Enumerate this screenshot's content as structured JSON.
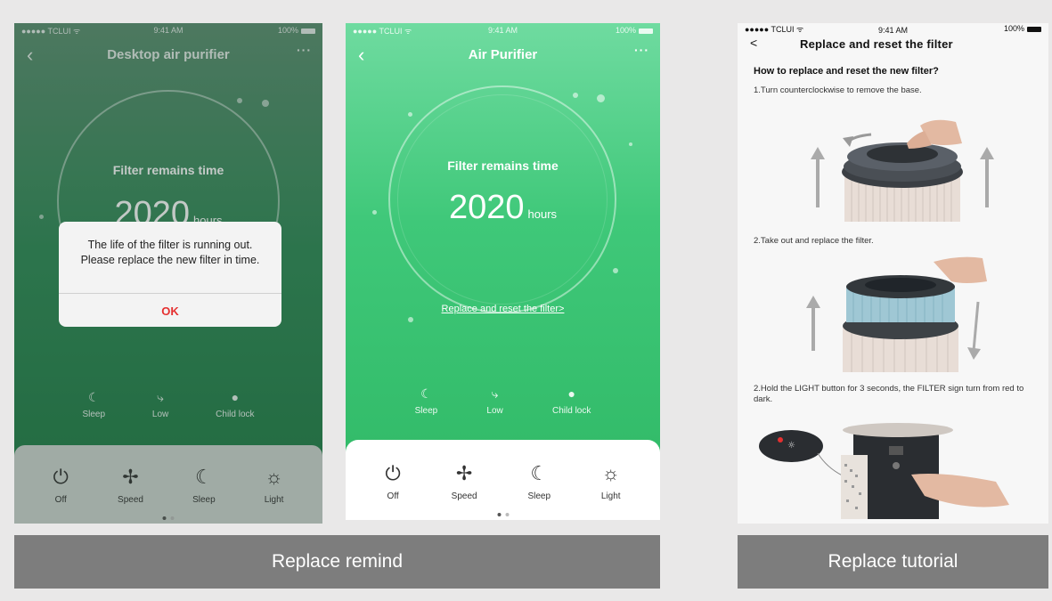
{
  "status": {
    "carrier": "●●●●● TCLUI ᯤ",
    "time": "9:41 AM",
    "battery": "100%"
  },
  "phone1": {
    "title": "Desktop air purifier",
    "filter_label": "Filter remains time",
    "hours_num": "2020",
    "hours_unit": "hours",
    "dialog": {
      "message": "The life of the filter is running out. Please replace the new filter in time.",
      "ok": "OK"
    },
    "modes": [
      {
        "label": "Sleep"
      },
      {
        "label": "Low"
      },
      {
        "label": "Child lock"
      }
    ],
    "controls": [
      {
        "label": "Off"
      },
      {
        "label": "Speed"
      },
      {
        "label": "Sleep"
      },
      {
        "label": "Light"
      }
    ]
  },
  "phone2": {
    "title": "Air Purifier",
    "filter_label": "Filter remains time",
    "hours_num": "2020",
    "hours_unit": "hours",
    "replace_link": "Replace and reset the filter>",
    "modes": [
      {
        "label": "Sleep"
      },
      {
        "label": "Low"
      },
      {
        "label": "Child lock"
      }
    ],
    "controls": [
      {
        "label": "Off"
      },
      {
        "label": "Speed"
      },
      {
        "label": "Sleep"
      },
      {
        "label": "Light"
      }
    ]
  },
  "phone3": {
    "status_carrier": "●●●●● TCLUI ᯤ",
    "status_time": "9:41 AM",
    "status_battery": "100%",
    "title": "Replace and reset the filter",
    "heading": "How to replace and reset the new filter?",
    "step1": "1.Turn counterclockwise to remove the base.",
    "step2": "2.Take out and replace the filter.",
    "step3": "2.Hold the LIGHT button for 3 seconds, the FILTER sign turn from red to dark."
  },
  "captions": {
    "left": "Replace remind",
    "right": "Replace tutorial"
  },
  "icons": {
    "back": "‹",
    "more": "···",
    "sleep": "☾",
    "low": "⤷",
    "child_lock": "●",
    "off": "⏻",
    "speed": "✢",
    "light": "☼"
  },
  "colors": {
    "green_light": "#3fc879",
    "green_dark": "#1f7c46",
    "ok_red": "#e53030",
    "caption_gray": "#7d7d7d"
  }
}
